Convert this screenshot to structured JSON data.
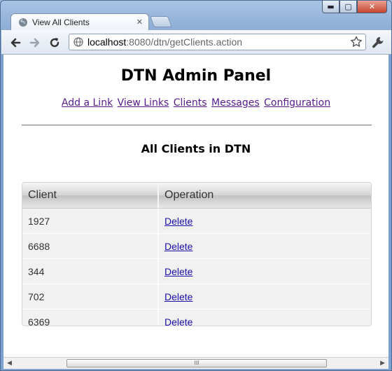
{
  "window": {
    "tab_title": "View All Clients",
    "url_host": "localhost",
    "url_rest": ":8080/dtn/getClients.action",
    "minimize_glyph": "▬",
    "maximize_glyph": "▢",
    "close_glyph": "✕"
  },
  "page": {
    "title": "DTN Admin Panel",
    "nav": [
      "Add a Link",
      "View Links",
      "Clients",
      "Messages",
      "Configuration"
    ],
    "section_title": "All Clients in DTN"
  },
  "table": {
    "headers": [
      "Client",
      "Operation"
    ],
    "rows": [
      {
        "client": "1927",
        "operation": "Delete"
      },
      {
        "client": "6688",
        "operation": "Delete"
      },
      {
        "client": "344",
        "operation": "Delete"
      },
      {
        "client": "702",
        "operation": "Delete"
      },
      {
        "client": "6369",
        "operation": "Delete"
      }
    ]
  },
  "scrollbar": {
    "thumb_grip": "III"
  },
  "icons": {
    "back": "back-arrow-icon",
    "forward": "forward-arrow-icon",
    "reload": "reload-icon",
    "bookmark": "star-icon",
    "menu": "wrench-icon"
  }
}
